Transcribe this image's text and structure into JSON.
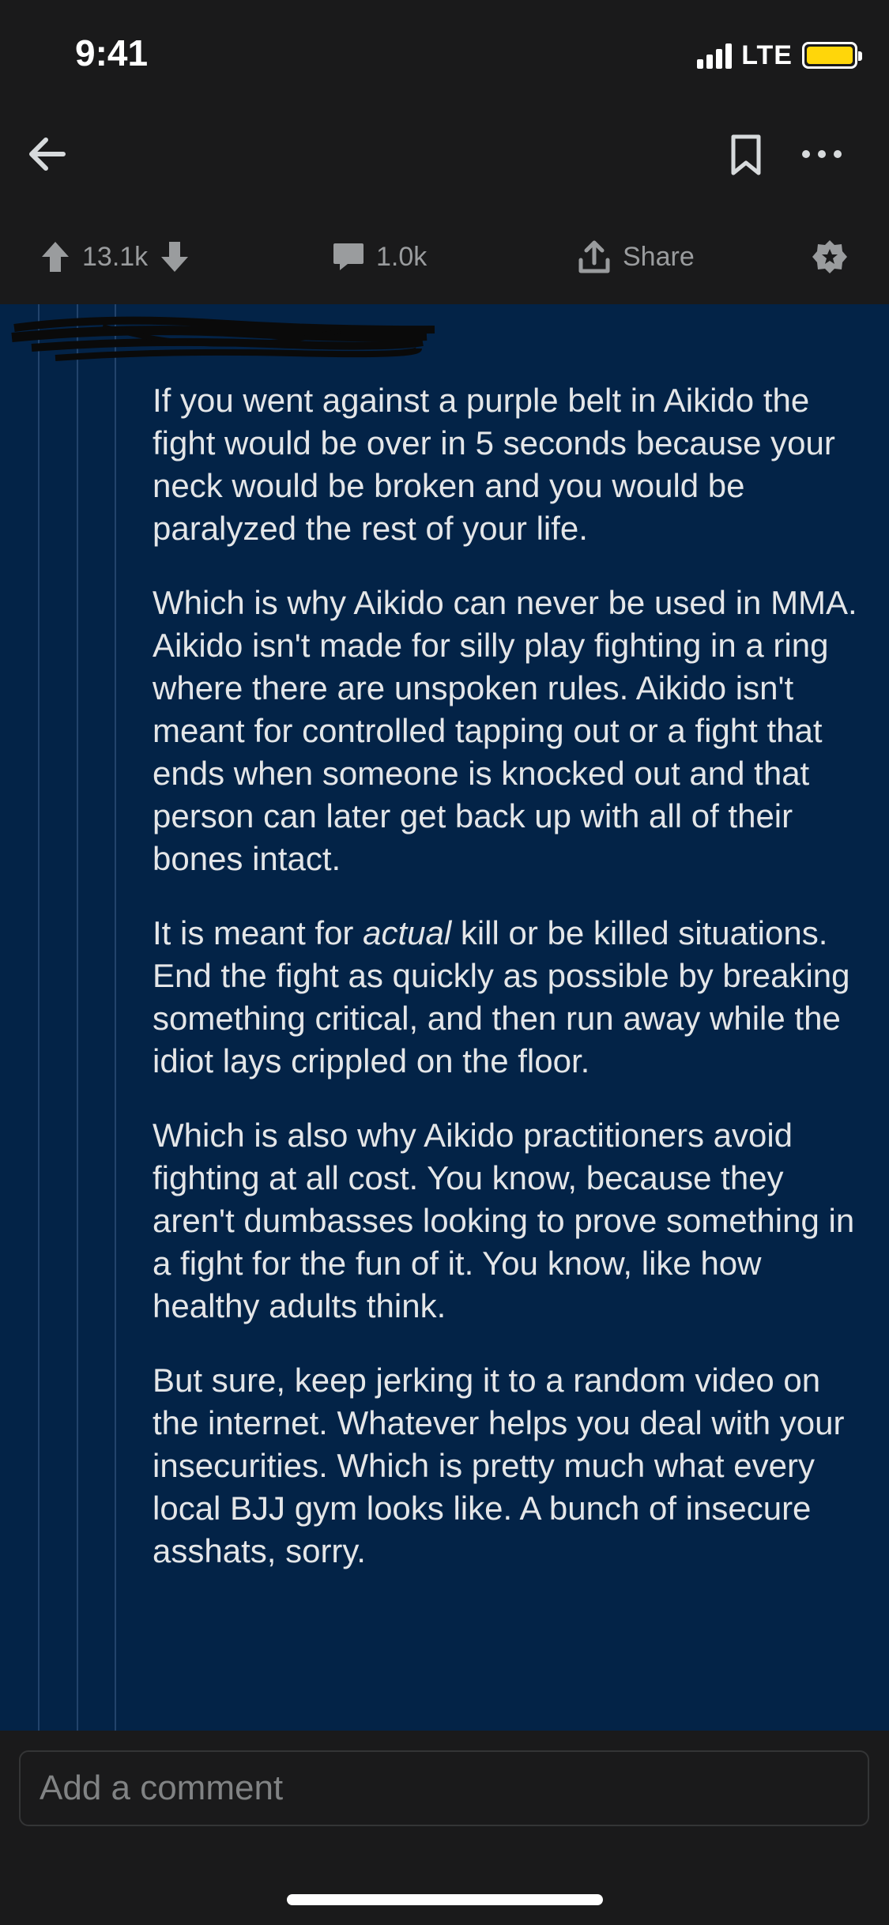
{
  "status_bar": {
    "time": "9:41",
    "network": "LTE",
    "battery_color": "#ffd60a"
  },
  "nav": {
    "back_icon": "arrow-left-icon",
    "bookmark_icon": "bookmark-icon",
    "more_icon": "more-horizontal-icon"
  },
  "actions": {
    "upvotes": "13.1k",
    "comments": "1.0k",
    "share_label": "Share"
  },
  "comment": {
    "paragraphs": [
      "If you went against a purple belt in Aikido the fight would be over in 5 seconds because your neck would be broken and you would be paralyzed the rest of your life.",
      "Which is why Aikido can never be used in MMA. Aikido isn't made for silly play fighting in a ring where there are unspoken rules. Aikido isn't meant for controlled tapping out or a fight that ends when someone is knocked out and that person can later get back up with all of their bones intact.",
      "",
      "Which is also why Aikido practitioners avoid fighting at all cost. You know, because they aren't dumbasses looking to prove something in a fight for the fun of it. You know, like how healthy adults think.",
      "But sure, keep jerking it to a random video on the internet. Whatever helps you deal with your insecurities. Which is pretty much what every local BJJ gym looks like. A bunch of insecure asshats, sorry."
    ],
    "p3_before": "It is meant for ",
    "p3_emphasis": "actual",
    "p3_after": " kill or be killed situations. End the fight as quickly as possible by breaking something critical, and then run away while the idiot lays crippled on the floor."
  },
  "composer": {
    "placeholder": "Add a comment"
  },
  "colors": {
    "background": "#1a1a1b",
    "comment_bg": "#032347",
    "text": "#e4e6e8",
    "muted": "#9a9c9e"
  }
}
